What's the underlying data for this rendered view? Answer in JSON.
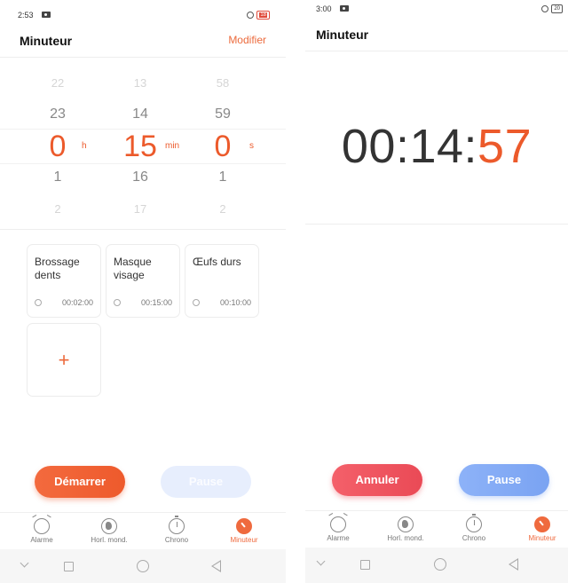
{
  "left": {
    "status": {
      "time": "2:53",
      "battery": "18"
    },
    "title": "Minuteur",
    "modify_label": "Modifier",
    "picker": {
      "hours": {
        "far_above": "22",
        "above": "23",
        "selected": "0",
        "below": "1",
        "far_below": "2",
        "unit": "h"
      },
      "minutes": {
        "far_above": "13",
        "above": "14",
        "selected": "15",
        "below": "16",
        "far_below": "17",
        "unit": "min"
      },
      "seconds": {
        "far_above": "58",
        "above": "59",
        "selected": "0",
        "below": "1",
        "far_below": "2",
        "unit": "s"
      }
    },
    "presets": [
      {
        "name": "Brossage dents",
        "duration": "00:02:00"
      },
      {
        "name": "Masque visage",
        "duration": "00:15:00"
      },
      {
        "name": "Œufs durs",
        "duration": "00:10:00"
      }
    ],
    "add_label": "+",
    "start_label": "Démarrer",
    "pause_label": "Pause"
  },
  "right": {
    "status": {
      "time": "3:00",
      "battery": "20"
    },
    "title": "Minuteur",
    "countdown": {
      "hm": "00:14:",
      "seconds": "57"
    },
    "cancel_label": "Annuler",
    "pause_label": "Pause"
  },
  "tabs": [
    {
      "label": "Alarme",
      "icon": "alarm-icon"
    },
    {
      "label": "Horl. mond.",
      "icon": "globe-icon"
    },
    {
      "label": "Chrono",
      "icon": "stopwatch-icon"
    },
    {
      "label": "Minuteur",
      "icon": "timer-icon",
      "active": true
    }
  ],
  "colors": {
    "accent": "#ec5a2b",
    "cancel": "#ea4a56",
    "pause": "#7aa3f2"
  }
}
